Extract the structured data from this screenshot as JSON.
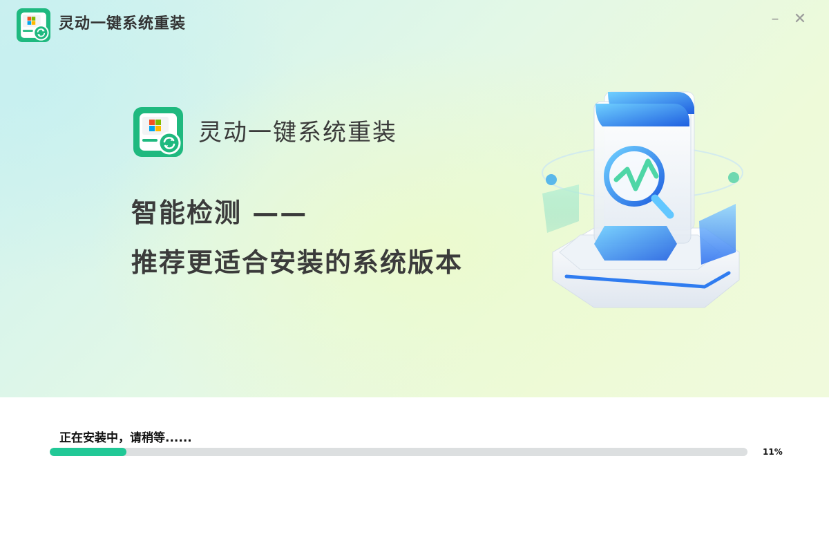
{
  "window": {
    "title": "灵动一键系统重装",
    "minimize_glyph": "–",
    "close_glyph": "✕"
  },
  "hero": {
    "brand": "灵动一键系统重装",
    "headline_line1": "智能检测 ——",
    "headline_line2": "推荐更适合安装的系统版本"
  },
  "progress": {
    "status": "正在安装中，请稍等......",
    "percent_label": "11%",
    "value": 0.11
  },
  "icons": {
    "app_logo": "windows-reinstall-logo",
    "illustration": "system-detection-magnifier-illustration"
  },
  "colors": {
    "accent": "#21c896",
    "logo_green": "#1fb97f",
    "illustration_blue": "#2f7cf0"
  }
}
